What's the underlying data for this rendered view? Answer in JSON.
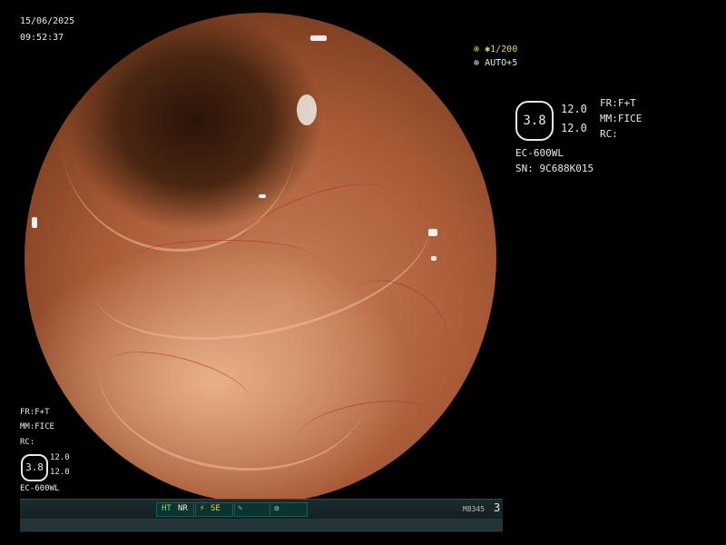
{
  "overlay_top_left": {
    "date": "15/06/2025",
    "time": "09:52:37"
  },
  "overlay_top_right_small": {
    "shutter": "1/200",
    "auto": "AUTO+5"
  },
  "settings_right": {
    "badge_value": "3.8",
    "value_1": "12.0",
    "value_2": "12.0",
    "fr": "FR:F+T",
    "mm": "MM:FICE",
    "rc": "RC:",
    "model": "EC-600WL",
    "serial": "SN: 9C688K015"
  },
  "settings_bottom_left": {
    "fr": "FR:F+T",
    "mm": "MM:FICE",
    "rc": "RC:",
    "badge_value": "3.8",
    "value_1": "12.0",
    "value_2": "12.0",
    "model": "EC-600WL"
  },
  "status_bar": {
    "ht": "HT",
    "nr": "NR",
    "se": "SE",
    "code": "M8345",
    "page": "3"
  },
  "colors": {
    "overlay_text": "#e8e8e8",
    "shutter_accent": "#e8d64a",
    "status_green": "#7fe07f"
  }
}
